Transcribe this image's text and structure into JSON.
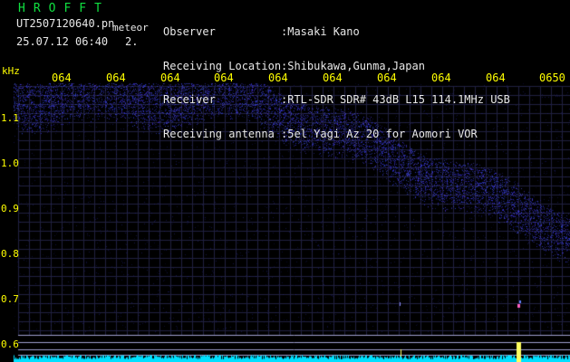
{
  "header": {
    "program": "HROFFT",
    "filename": "UT2507120640.pn",
    "detection": "meteor",
    "datetime": "25.07.12 06:40",
    "count": "2."
  },
  "station": [
    {
      "label": "Observer",
      "value": ":Masaki Kano"
    },
    {
      "label": "Receiving Location",
      "value": ":Shibukawa,Gunma,Japan"
    },
    {
      "label": "Receiver",
      "value": ":RTL-SDR SDR# 43dB L15 114.1MHz USB"
    },
    {
      "label": "Receiving antenna",
      "value": ":5el Yagi Az 20 for Aomori VOR"
    }
  ],
  "chart_data": {
    "type": "heatmap",
    "ylabel": "kHz",
    "y_ticks": [
      "1.1",
      "1.0",
      "0.9",
      "0.8",
      "0.7",
      "0.6"
    ],
    "x_ticks": [
      "064",
      "064",
      "064",
      "064",
      "064",
      "064",
      "064",
      "064",
      "064",
      "0650"
    ],
    "colors": {
      "background": "#000000",
      "noise": "#2828c8",
      "axis_text": "#ffff00",
      "spectrum": "#00e0ff",
      "grid": "#202040"
    }
  }
}
